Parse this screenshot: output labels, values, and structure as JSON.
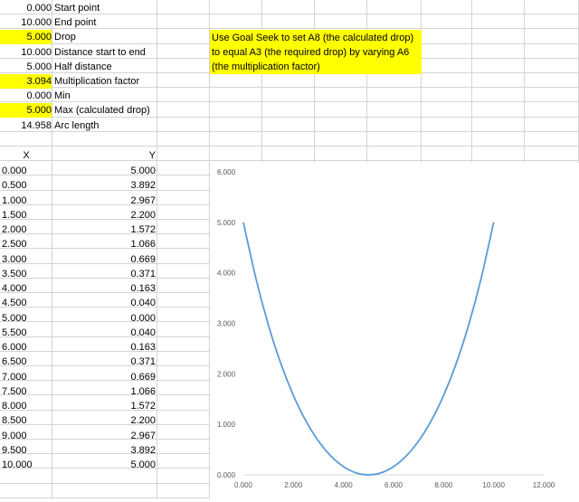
{
  "params": [
    {
      "value": "0.000",
      "label": "Start point",
      "highlight": false
    },
    {
      "value": "10.000",
      "label": "End point",
      "highlight": false
    },
    {
      "value": "5.000",
      "label": "Drop",
      "highlight": true
    },
    {
      "value": "10.000",
      "label": "Distance start to end",
      "highlight": false
    },
    {
      "value": "5.000",
      "label": "Half distance",
      "highlight": false
    },
    {
      "value": "3.094",
      "label": "Multiplication factor",
      "highlight": true
    },
    {
      "value": "0.000",
      "label": "Min",
      "highlight": false
    },
    {
      "value": "5.000",
      "label": "Max (calculated drop)",
      "highlight": true
    },
    {
      "value": "14.958",
      "label": "Arc length",
      "highlight": false
    }
  ],
  "note": [
    "Use Goal Seek to set A8 (the calculated drop)",
    "to equal A3 (the required drop) by varying A6",
    "(the multiplication factor)"
  ],
  "table": {
    "headers": [
      "X",
      "Y"
    ],
    "rows": [
      [
        "0.000",
        "5.000"
      ],
      [
        "0.500",
        "3.892"
      ],
      [
        "1.000",
        "2.967"
      ],
      [
        "1.500",
        "2.200"
      ],
      [
        "2.000",
        "1.572"
      ],
      [
        "2.500",
        "1.066"
      ],
      [
        "3.000",
        "0.669"
      ],
      [
        "3.500",
        "0.371"
      ],
      [
        "4.000",
        "0.163"
      ],
      [
        "4.500",
        "0.040"
      ],
      [
        "5.000",
        "0.000"
      ],
      [
        "5.500",
        "0.040"
      ],
      [
        "6.000",
        "0.163"
      ],
      [
        "6.500",
        "0.371"
      ],
      [
        "7.000",
        "0.669"
      ],
      [
        "7.500",
        "1.066"
      ],
      [
        "8.000",
        "1.572"
      ],
      [
        "8.500",
        "2.200"
      ],
      [
        "9.000",
        "2.967"
      ],
      [
        "9.500",
        "3.892"
      ],
      [
        "10.000",
        "5.000"
      ]
    ]
  },
  "chart_data": {
    "type": "line",
    "title": "",
    "xlabel": "",
    "ylabel": "",
    "xlim": [
      0,
      12
    ],
    "ylim": [
      0,
      6
    ],
    "xticks": [
      "0.000",
      "2.000",
      "4.000",
      "6.000",
      "8.000",
      "10.000",
      "12.000"
    ],
    "yticks": [
      "0.000",
      "1.000",
      "2.000",
      "3.000",
      "4.000",
      "5.000",
      "6.000"
    ],
    "grid": false,
    "legend": "none",
    "line_color": "#5b9bd5",
    "series": [
      {
        "x": [
          0,
          0.5,
          1,
          1.5,
          2,
          2.5,
          3,
          3.5,
          4,
          4.5,
          5,
          5.5,
          6,
          6.5,
          7,
          7.5,
          8,
          8.5,
          9,
          9.5,
          10
        ],
        "y": [
          5.0,
          3.892,
          2.967,
          2.2,
          1.572,
          1.066,
          0.669,
          0.371,
          0.163,
          0.04,
          0.0,
          0.04,
          0.163,
          0.371,
          0.669,
          1.066,
          1.572,
          2.2,
          2.967,
          3.892,
          5.0
        ]
      }
    ]
  }
}
